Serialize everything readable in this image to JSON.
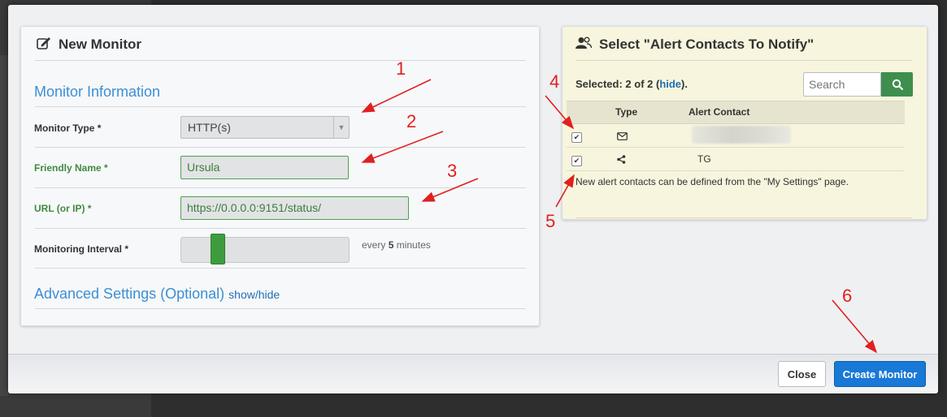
{
  "new_monitor": {
    "title": "New Monitor",
    "monitor_information": "Monitor Information",
    "fields": {
      "monitor_type": {
        "label": "Monitor Type *",
        "value": "HTTP(s)"
      },
      "friendly_name": {
        "label": "Friendly Name *",
        "value": "Ursula"
      },
      "url": {
        "label": "URL (or IP) *",
        "value": "https://0.0.0.0:9151/status/"
      },
      "interval": {
        "label": "Monitoring Interval *",
        "prefix": "every",
        "value": "5",
        "suffix": "minutes",
        "position_fraction": 0.19
      }
    },
    "advanced": {
      "label": "Advanced Settings (Optional)",
      "toggle": "show/hide"
    }
  },
  "alert_contacts": {
    "title": "Select \"Alert Contacts To Notify\"",
    "selected_prefix": "Selected: 2 of 2 (",
    "hide_link": "hide",
    "selected_suffix": ").",
    "search_placeholder": "Search",
    "columns": [
      "Type",
      "Alert Contact"
    ],
    "rows": [
      {
        "checked": true,
        "type_icon": "envelope-icon",
        "contact": ""
      },
      {
        "checked": true,
        "type_icon": "share-icon",
        "contact": "TG"
      }
    ],
    "note": "New alert contacts can be defined from the \"My Settings\" page."
  },
  "footer": {
    "close": "Close",
    "create": "Create Monitor"
  },
  "annotations": [
    "1",
    "2",
    "3",
    "4",
    "5",
    "6"
  ],
  "colors": {
    "accent_green": "#3e9c3e",
    "primary_blue": "#1879d6",
    "annotation_red": "#e02020",
    "section_blue": "#3c8fd3"
  }
}
